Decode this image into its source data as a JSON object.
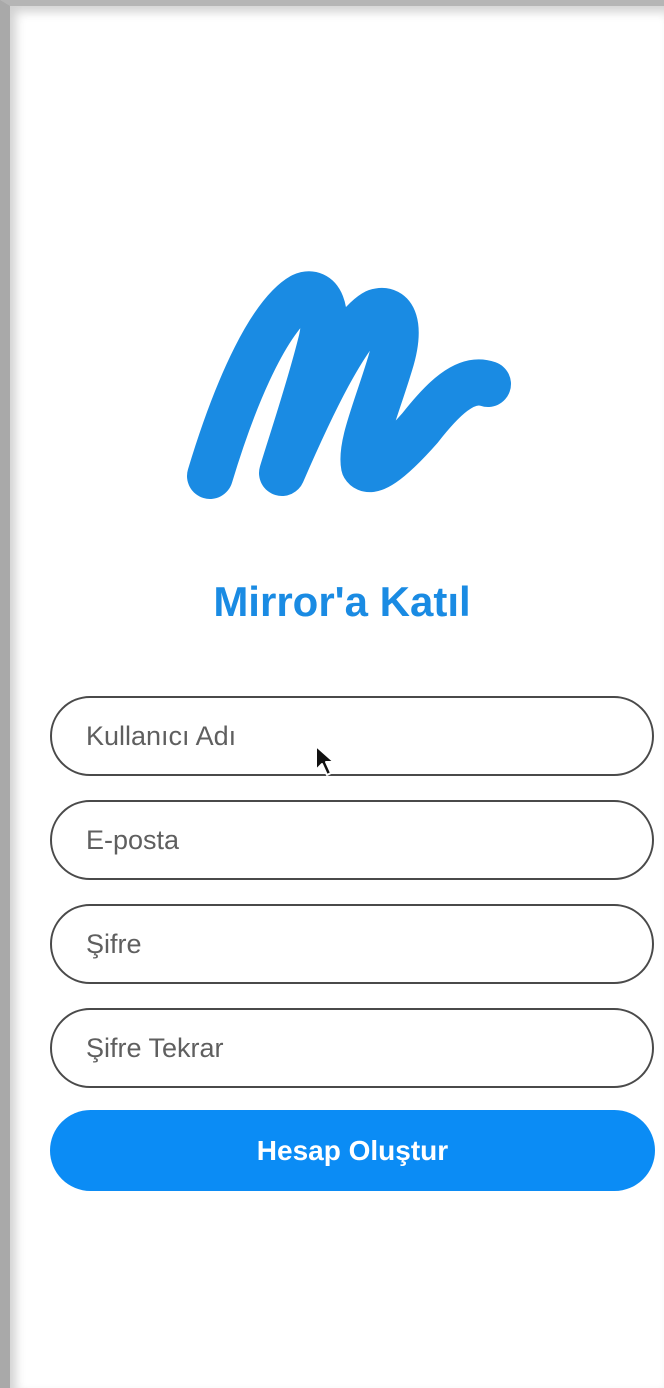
{
  "signup": {
    "title": "Mirror'a Katıl",
    "fields": [
      {
        "placeholder": "Kullanıcı Adı",
        "value": ""
      },
      {
        "placeholder": "E-posta",
        "value": ""
      },
      {
        "placeholder": "Şifre",
        "value": ""
      },
      {
        "placeholder": "Şifre Tekrar",
        "value": ""
      }
    ],
    "submit_label": "Hesap Oluştur"
  },
  "icons": {
    "logo": "mirror-m-logo",
    "cursor": "mouse-pointer-icon"
  },
  "colors": {
    "brand": "#1a8be3",
    "button": "#0b8cf5",
    "field_border": "#4a4a4a"
  }
}
